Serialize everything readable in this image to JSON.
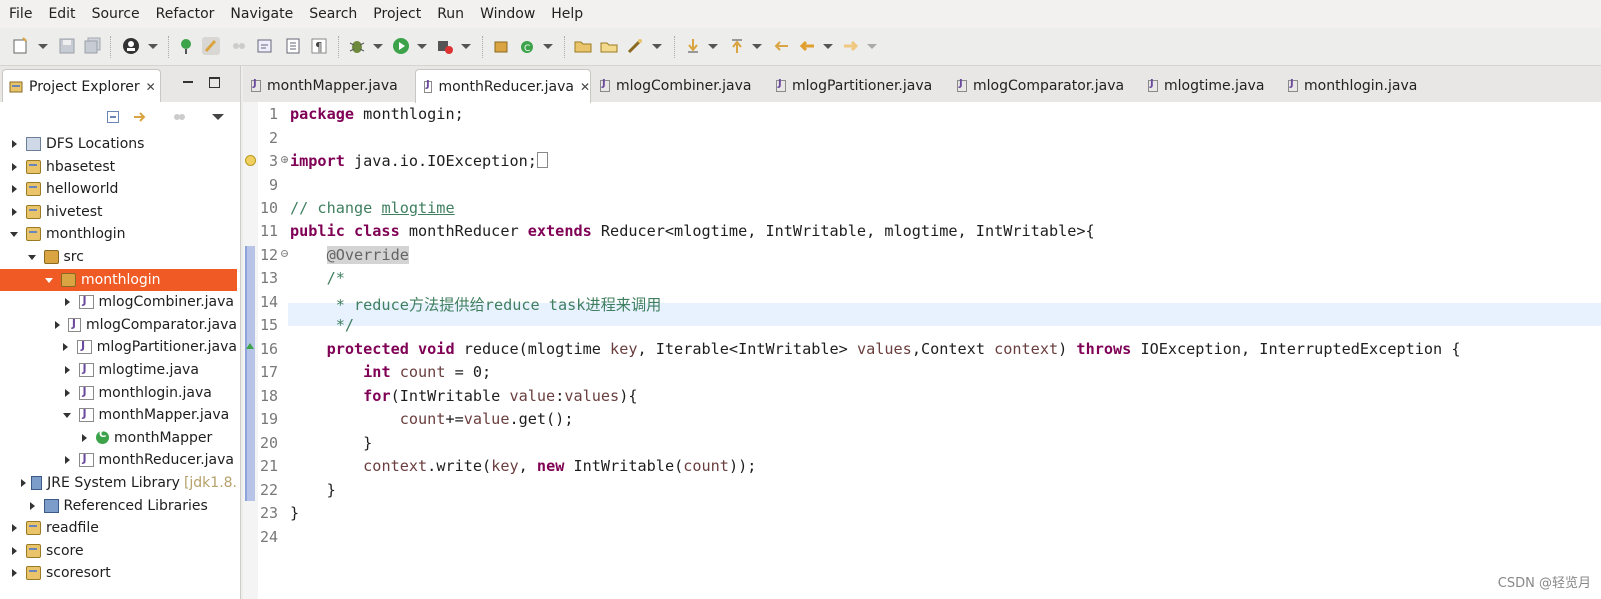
{
  "menubar": {
    "items": [
      "File",
      "Edit",
      "Source",
      "Refactor",
      "Navigate",
      "Search",
      "Project",
      "Run",
      "Window",
      "Help"
    ]
  },
  "toolbar": {
    "icons": [
      "new-icon",
      "save-icon",
      "save-all-icon",
      "profile-icon",
      "open-type-icon",
      "mark-occurrences-icon",
      "build-icon",
      "task-icon",
      "outline-icon",
      "show-whitespace-icon",
      "debug-icon",
      "run-icon",
      "external-tools-icon",
      "new-java-package-icon",
      "new-java-class-icon",
      "open-folder-icon",
      "open-file-icon",
      "search-icon",
      "next-annotation-icon",
      "previous-annotation-icon",
      "last-edit-icon",
      "back-icon",
      "forward-icon"
    ]
  },
  "explorer": {
    "tab_title": "Project Explorer",
    "tree": [
      {
        "label": "DFS Locations",
        "indent": 0,
        "state": "closed",
        "icon": "dfs-icon"
      },
      {
        "label": "hbasetest",
        "indent": 0,
        "state": "closed",
        "icon": "project-icon"
      },
      {
        "label": "helloworld",
        "indent": 0,
        "state": "closed",
        "icon": "project-icon"
      },
      {
        "label": "hivetest",
        "indent": 0,
        "state": "closed",
        "icon": "project-icon"
      },
      {
        "label": "monthlogin",
        "indent": 0,
        "state": "open",
        "icon": "project-icon"
      },
      {
        "label": "src",
        "indent": 1,
        "state": "open",
        "icon": "source-folder-icon"
      },
      {
        "label": "monthlogin",
        "indent": 2,
        "state": "open",
        "icon": "package-icon",
        "selected": true
      },
      {
        "label": "mlogCombiner.java",
        "indent": 3,
        "state": "closed",
        "icon": "java-file-icon"
      },
      {
        "label": "mlogComparator.java",
        "indent": 3,
        "state": "closed",
        "icon": "java-file-icon"
      },
      {
        "label": "mlogPartitioner.java",
        "indent": 3,
        "state": "closed",
        "icon": "java-file-icon"
      },
      {
        "label": "mlogtime.java",
        "indent": 3,
        "state": "closed",
        "icon": "java-file-icon"
      },
      {
        "label": "monthlogin.java",
        "indent": 3,
        "state": "closed",
        "icon": "java-file-icon"
      },
      {
        "label": "monthMapper.java",
        "indent": 3,
        "state": "open",
        "icon": "java-file-icon"
      },
      {
        "label": "monthMapper",
        "indent": 4,
        "state": "closed",
        "icon": "class-icon"
      },
      {
        "label": "monthReducer.java",
        "indent": 3,
        "state": "closed",
        "icon": "java-file-icon"
      },
      {
        "label": "JRE System Library",
        "suffix": "[jdk1.8.",
        "indent": 1,
        "state": "closed",
        "icon": "library-icon"
      },
      {
        "label": "Referenced Libraries",
        "indent": 1,
        "state": "closed",
        "icon": "library-icon"
      },
      {
        "label": "readfile",
        "indent": 0,
        "state": "closed",
        "icon": "project-icon"
      },
      {
        "label": "score",
        "indent": 0,
        "state": "closed",
        "icon": "project-icon"
      },
      {
        "label": "scoresort",
        "indent": 0,
        "state": "closed",
        "icon": "project-icon"
      }
    ]
  },
  "editor": {
    "tabs": [
      {
        "label": "monthMapper.java",
        "active": false
      },
      {
        "label": "monthReducer.java",
        "active": true
      },
      {
        "label": "mlogCombiner.java",
        "active": false
      },
      {
        "label": "mlogPartitioner.java",
        "active": false
      },
      {
        "label": "mlogComparator.java",
        "active": false
      },
      {
        "label": "mlogtime.java",
        "active": false
      },
      {
        "label": "monthlogin.java",
        "active": false
      }
    ],
    "line_numbers": [
      "1",
      "2",
      "3",
      "9",
      "10",
      "11",
      "12",
      "13",
      "14",
      "15",
      "16",
      "17",
      "18",
      "19",
      "20",
      "21",
      "22",
      "23",
      "24"
    ]
  },
  "watermark": "CSDN @轻览月"
}
